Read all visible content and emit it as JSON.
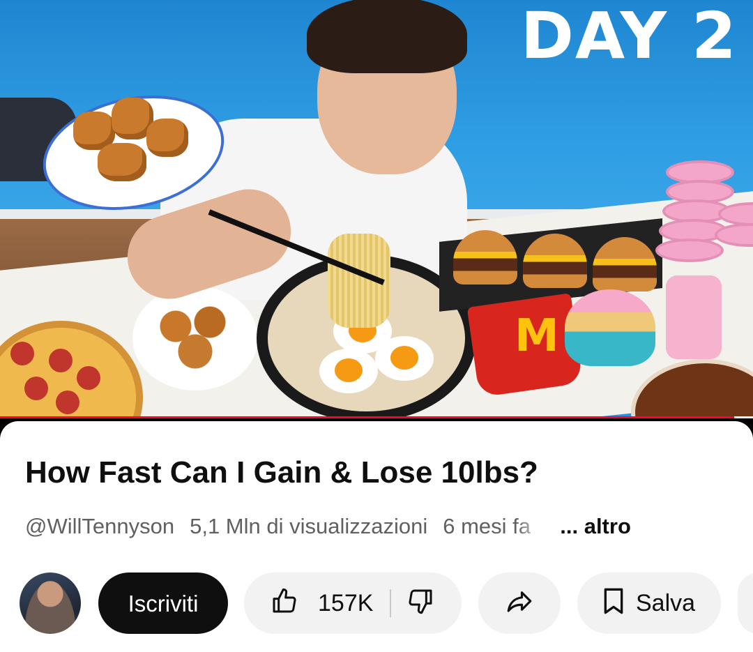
{
  "thumbnail": {
    "overlay_text": "DAY 2",
    "progress_fraction": 0.975,
    "progress_color": "#ff0033"
  },
  "video": {
    "title": "How Fast Can I Gain & Lose 10lbs?",
    "channel": "@WillTennyson",
    "views": "5,1 Mln di visualizzazioni",
    "age": "6 mesi fa",
    "more_label": "... altro"
  },
  "actions": {
    "subscribe_label": "Iscriviti",
    "like_count": "157K",
    "save_label": "Salva",
    "icons": [
      "thumb-up-icon",
      "thumb-down-icon",
      "share-icon",
      "bookmark-icon"
    ]
  }
}
